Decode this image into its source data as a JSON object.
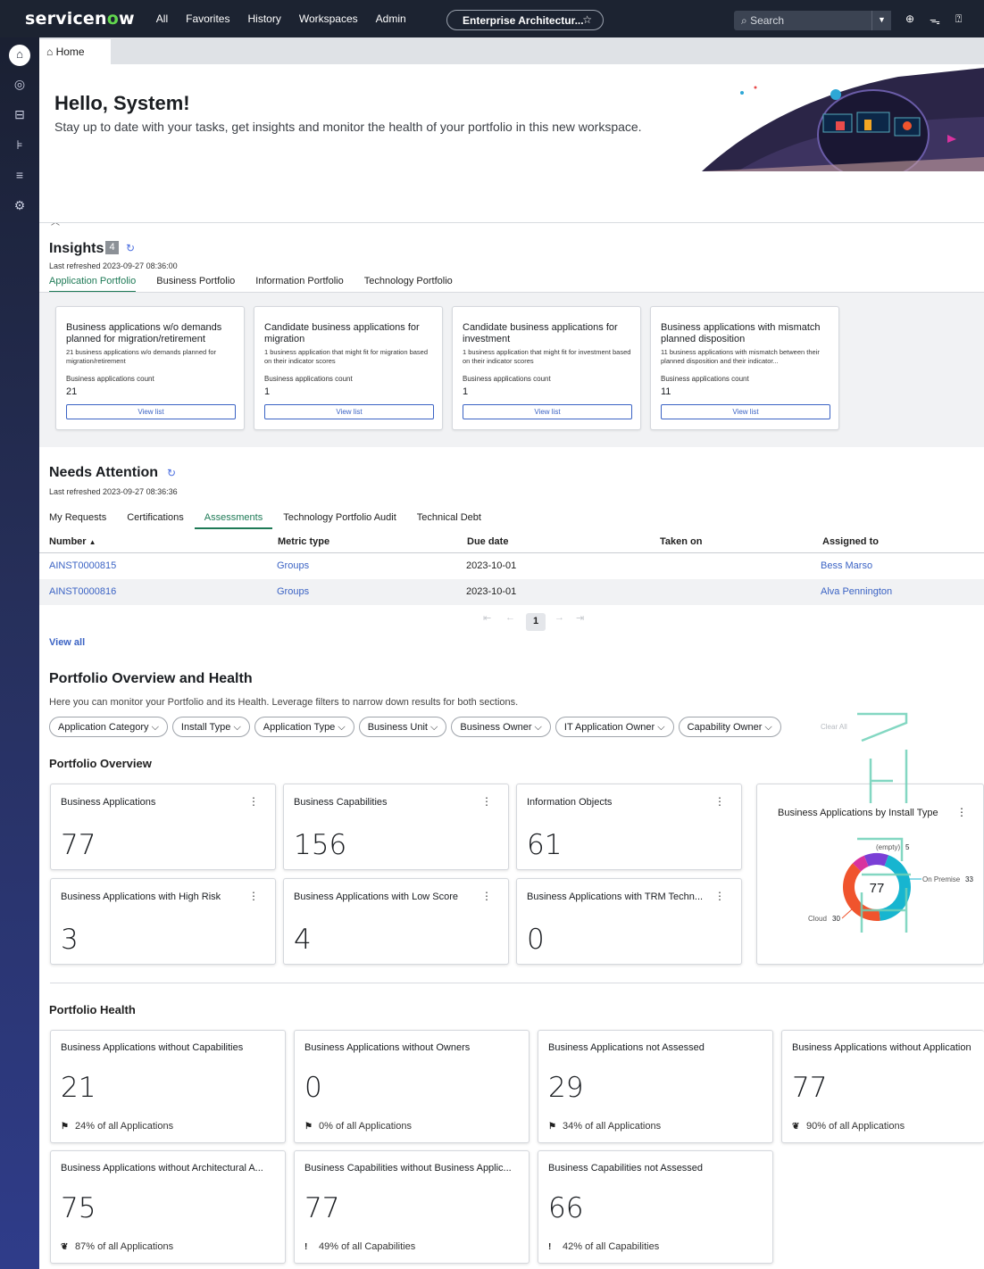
{
  "header": {
    "logo_text": "servicenow",
    "nav": [
      "All",
      "Favorites",
      "History",
      "Workspaces",
      "Admin"
    ],
    "context": "Enterprise Architectur...",
    "search_placeholder": "Search"
  },
  "tab": {
    "home_label": "Home"
  },
  "greeting": {
    "title": "Hello, System!",
    "subtitle": "Stay up to date with your tasks, get insights and monitor the health of your portfolio in this new workspace."
  },
  "insights": {
    "title": "Insights",
    "count": "4",
    "refreshed": "Last refreshed 2023-09-27 08:36:00",
    "tabs": [
      "Application Portfolio",
      "Business Portfolio",
      "Information Portfolio",
      "Technology Portfolio"
    ],
    "cards": [
      {
        "title": "Business applications w/o demands planned for migration/retirement",
        "desc": "21 business applications w/o demands planned for migration/retirement",
        "label": "Business applications count",
        "count": "21",
        "button": "View list"
      },
      {
        "title": "Candidate business applications for migration",
        "desc": "1 business application that might fit for migration based on their indicator scores",
        "label": "Business applications count",
        "count": "1",
        "button": "View list"
      },
      {
        "title": "Candidate business applications for investment",
        "desc": "1 business application that might fit for investment based on their indicator scores",
        "label": "Business applications count",
        "count": "1",
        "button": "View list"
      },
      {
        "title": "Business applications with mismatch planned disposition",
        "desc": "11 business applications with mismatch between their planned disposition and their indicator...",
        "label": "Business applications count",
        "count": "11",
        "button": "View list"
      }
    ]
  },
  "attention": {
    "title": "Needs Attention",
    "refreshed": "Last refreshed 2023-09-27 08:36:36",
    "tabs": [
      "My Requests",
      "Certifications",
      "Assessments",
      "Technology Portfolio Audit",
      "Technical Debt"
    ],
    "columns": [
      "Number",
      "Metric type",
      "Due date",
      "Taken on",
      "Assigned to"
    ],
    "rows": [
      {
        "number": "AINST0000815",
        "metric": "Groups",
        "due": "2023-10-01",
        "taken": "",
        "assigned": "Bess Marso"
      },
      {
        "number": "AINST0000816",
        "metric": "Groups",
        "due": "2023-10-01",
        "taken": "",
        "assigned": "Alva Pennington"
      }
    ],
    "page": "1",
    "view_all": "View all"
  },
  "portfolio": {
    "title": "Portfolio Overview and Health",
    "subtitle": "Here you can monitor your Portfolio and its Health. Leverage filters to narrow down results for both sections.",
    "filters": [
      "Application Category",
      "Install Type",
      "Application Type",
      "Business Unit",
      "Business Owner",
      "IT Application Owner",
      "Capability Owner"
    ],
    "clear_all": "Clear All",
    "overview_title": "Portfolio Overview",
    "overview": [
      {
        "label": "Business Applications",
        "value": "77"
      },
      {
        "label": "Business Capabilities",
        "value": "156"
      },
      {
        "label": "Information Objects",
        "value": "61"
      },
      {
        "label": "Business Applications with High Risk",
        "value": "3"
      },
      {
        "label": "Business Applications with Low Score",
        "value": "4"
      },
      {
        "label": "Business Applications with TRM Techn...",
        "value": "0"
      }
    ],
    "donut": {
      "title": "Business Applications by Install Type",
      "total": "77",
      "slices": [
        {
          "label": "On Premise",
          "value": 33,
          "color": "#17b5d0"
        },
        {
          "label": "Cloud",
          "value": 30,
          "color": "#f0542d"
        },
        {
          "label": "(empty)",
          "value": 5,
          "color": "#d8329f"
        },
        {
          "label": "",
          "value": 9,
          "color": "#7a3fd6"
        }
      ]
    },
    "health_title": "Portfolio Health",
    "health": [
      {
        "label": "Business Applications without Capabilities",
        "value": "21",
        "pct": "24% of all Applications",
        "icon": "flag"
      },
      {
        "label": "Business Applications without Owners",
        "value": "0",
        "pct": "0% of all Applications",
        "icon": "flag"
      },
      {
        "label": "Business Applications not Assessed",
        "value": "29",
        "pct": "34% of all Applications",
        "icon": "flag"
      },
      {
        "label": "Business Applications without Application",
        "value": "77",
        "pct": "90% of all Applications",
        "icon": "fire"
      },
      {
        "label": "Business Applications without Architectural A...",
        "value": "75",
        "pct": "87% of all Applications",
        "icon": "fire"
      },
      {
        "label": "Business Capabilities without Business Applic...",
        "value": "77",
        "pct": "49% of all Capabilities",
        "icon": "exclaim"
      },
      {
        "label": "Business Capabilities not Assessed",
        "value": "66",
        "pct": "42% of all Capabilities",
        "icon": "exclaim"
      }
    ]
  }
}
